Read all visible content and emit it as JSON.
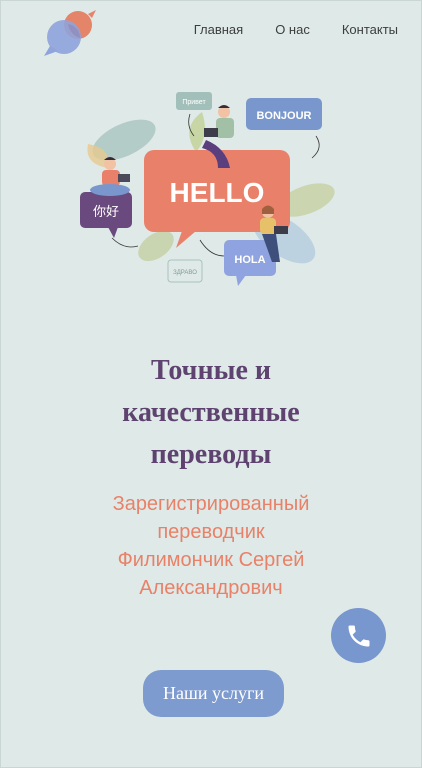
{
  "nav": {
    "items": [
      "Главная",
      "О нас",
      "Контакты"
    ]
  },
  "hero": {
    "bubble_main": "HELLO",
    "bubble_bonjour": "BONJOUR",
    "bubble_hola": "HOLA",
    "bubble_privet": "Привет",
    "bubble_zdravo": "ЗДРАВО",
    "bubble_chinese": "你好"
  },
  "headline": {
    "lines": [
      "Точные и",
      "качественные",
      "переводы"
    ]
  },
  "subheadline": {
    "lines": [
      "Зарегистрированный",
      "переводчик",
      "Филимончик Сергей",
      "Александрович"
    ]
  },
  "cta": {
    "label": "Наши услуги"
  },
  "icons": {
    "phone": "phone-icon",
    "logo": "speech-bubbles-logo"
  },
  "colors": {
    "background": "#dfeae8",
    "accent_orange": "#e98168",
    "accent_purple": "#5e426f",
    "accent_blue": "#7e9bd0"
  }
}
